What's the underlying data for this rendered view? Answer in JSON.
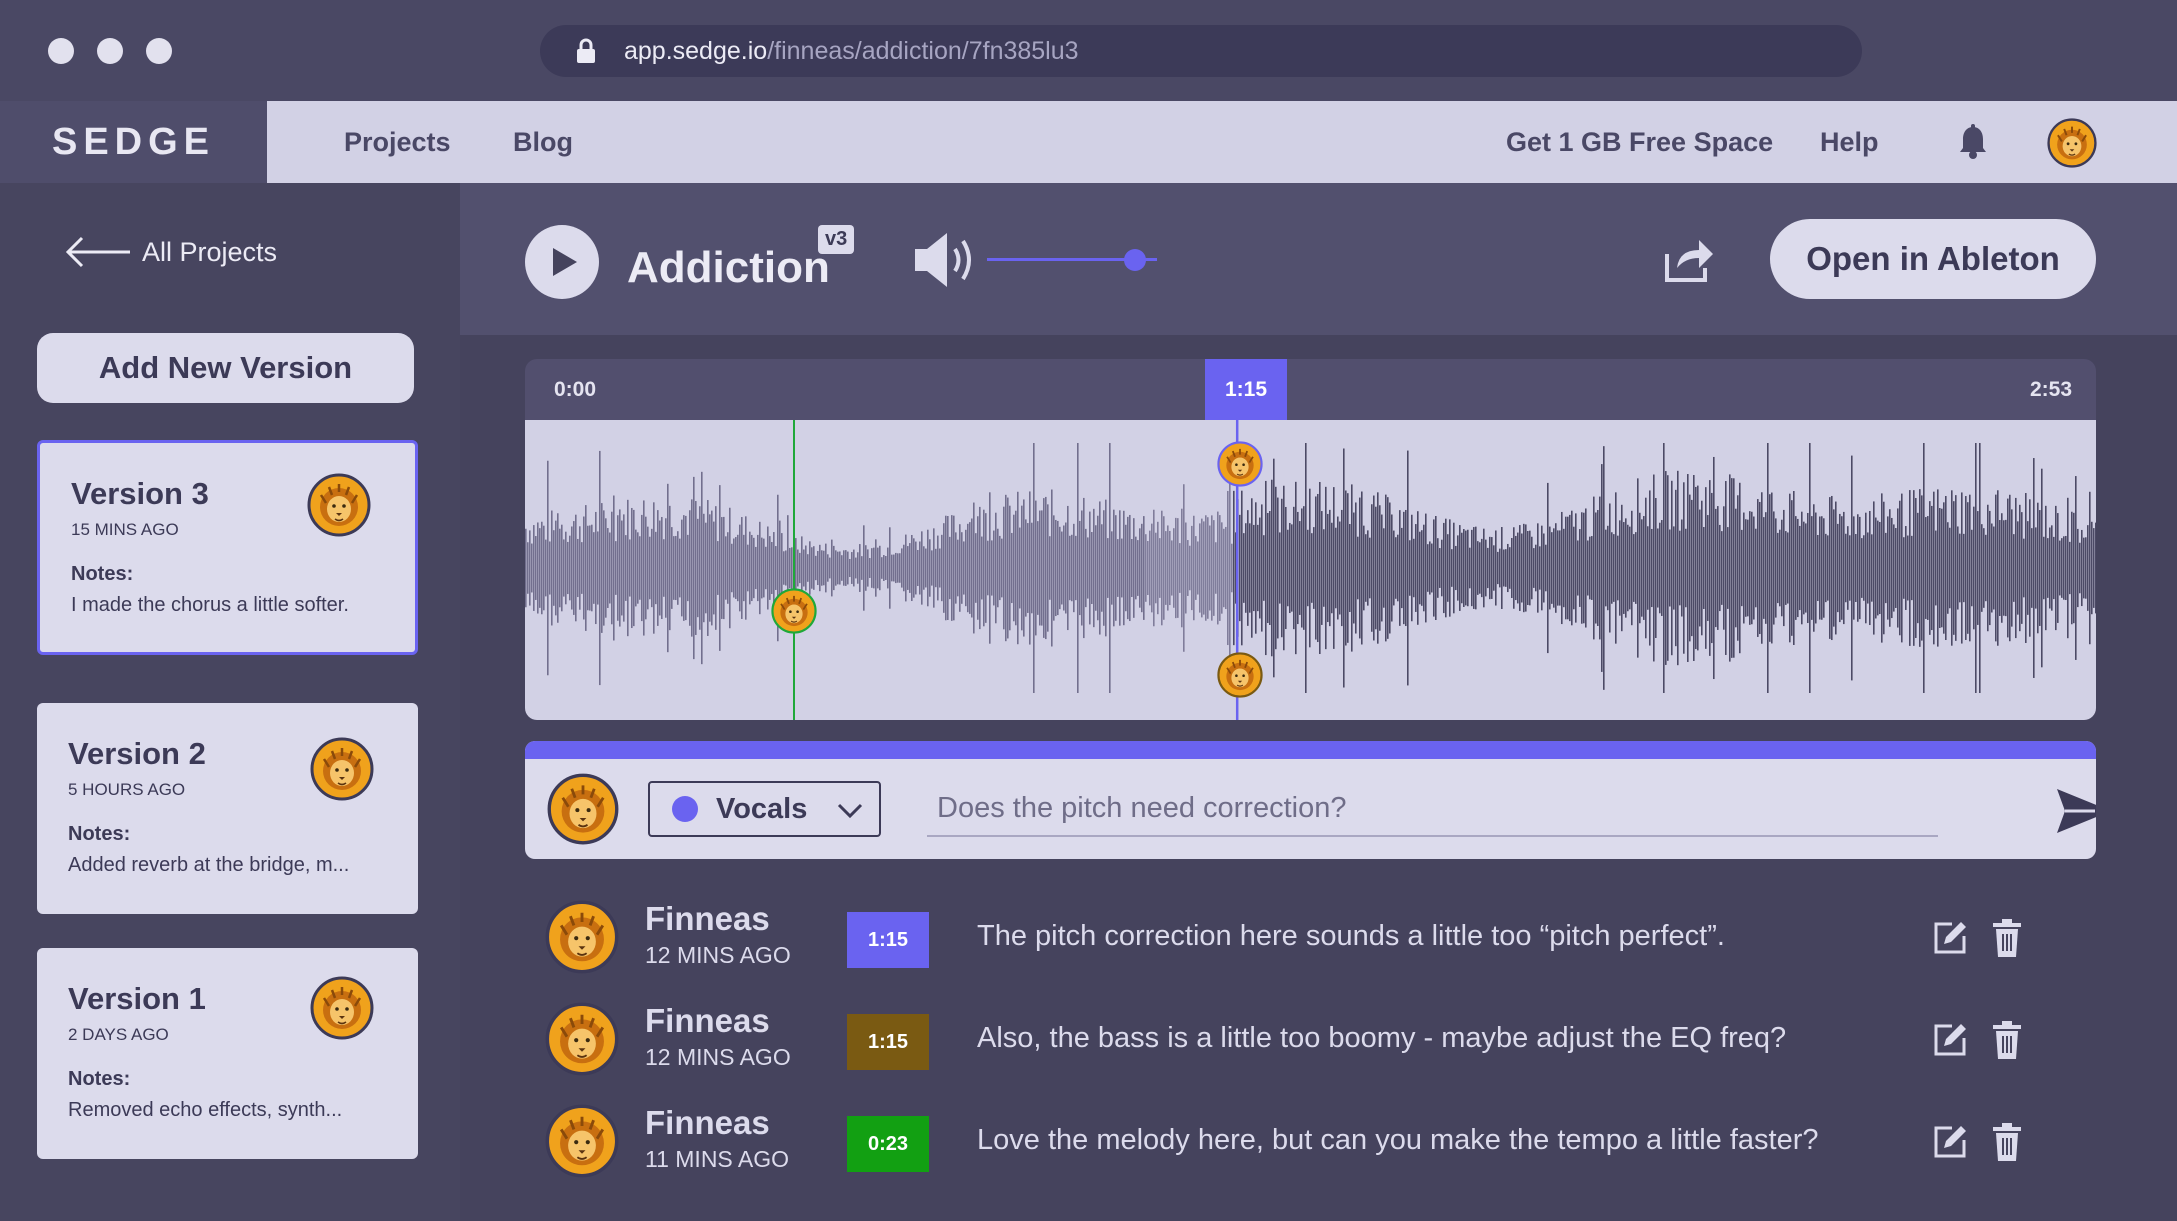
{
  "browser": {
    "url_domain": "app.sedge.io",
    "url_path": "/finneas/addiction/7fn385lu3"
  },
  "nav": {
    "logo": "SEDGE",
    "links": [
      "Projects",
      "Blog"
    ],
    "right_links": [
      "Get 1 GB Free Space",
      "Help"
    ]
  },
  "sidebar": {
    "back_label": "All Projects",
    "add_version_label": "Add New Version",
    "notes_label": "Notes:",
    "versions": [
      {
        "title": "Version 3",
        "time": "15 MINS AGO",
        "note": "I made the chorus a little softer.",
        "active": true
      },
      {
        "title": "Version 2",
        "time": "5 HOURS AGO",
        "note": "Added reverb at the bridge, m..."
      },
      {
        "title": "Version 1",
        "time": "2 DAYS AGO",
        "note": "Removed echo effects, synth..."
      }
    ]
  },
  "player": {
    "title": "Addiction",
    "version_badge": "v3",
    "volume_fraction": 0.87,
    "open_button": "Open in Ableton",
    "time_start": "0:00",
    "time_current": "1:15",
    "time_end": "2:53",
    "played_fraction": 0.45
  },
  "composer": {
    "channel": "Vocals",
    "channel_color": "#6a63f0",
    "placeholder": "Does the pitch need correction?"
  },
  "comments": [
    {
      "name": "Finneas",
      "time": "12 MINS AGO",
      "timestamp": "1:15",
      "color": "#6a63f0",
      "text": "The pitch correction here sounds a little too “pitch perfect”."
    },
    {
      "name": "Finneas",
      "time": "12 MINS AGO",
      "timestamp": "1:15",
      "color": "#7a5a12",
      "text": "Also, the bass is a little too boomy - maybe adjust the EQ freq?"
    },
    {
      "name": "Finneas",
      "time": "11 MINS AGO",
      "timestamp": "0:23",
      "color": "#12a012",
      "text": "Love the melody here, but can you make the tempo a little faster?"
    }
  ],
  "colors": {
    "accent": "#6a63f0",
    "marker_green": "#1fa83a"
  },
  "icons": [
    "lock-icon",
    "back-arrow-icon",
    "play-icon",
    "speaker-icon",
    "share-icon",
    "bell-icon",
    "chevron-down-icon",
    "send-icon",
    "edit-icon",
    "trash-icon",
    "lion-avatar"
  ]
}
